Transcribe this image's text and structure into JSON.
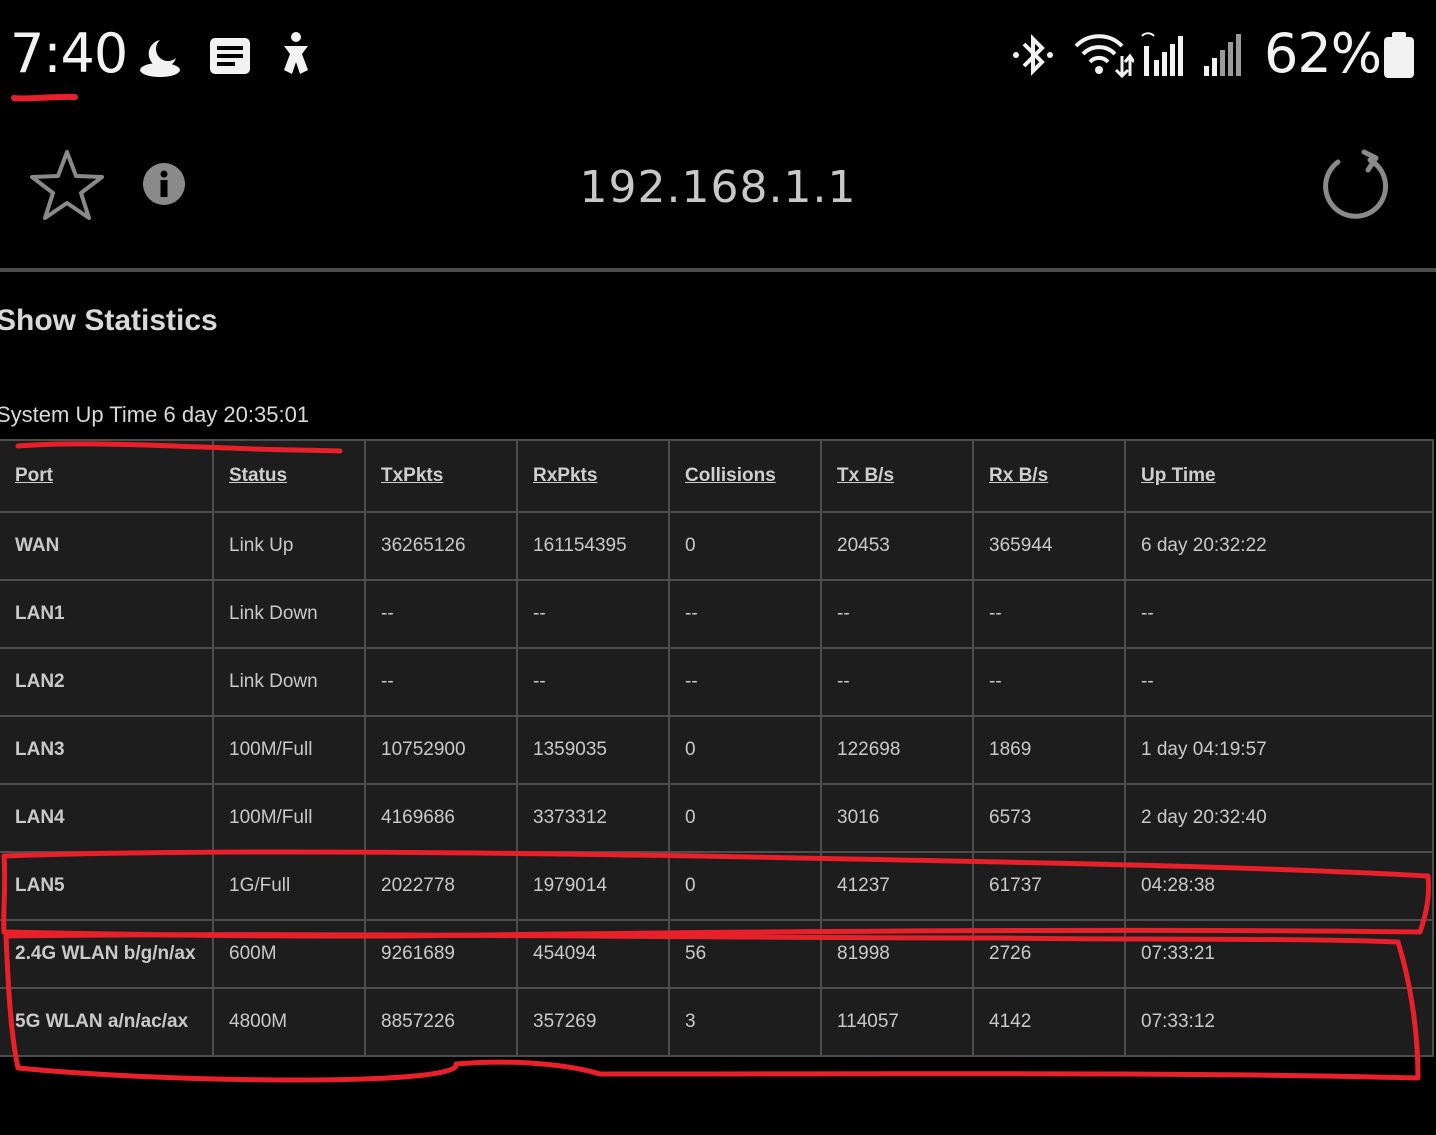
{
  "status_bar": {
    "time": "7:40",
    "battery": "62%",
    "icons": [
      "weather-night-icon",
      "notes-icon",
      "accessibility-icon",
      "bluetooth-icon",
      "wifi-icon",
      "signal-icon",
      "signal-icon-2",
      "battery-icon"
    ]
  },
  "browser": {
    "url": "192.168.1.1",
    "icons": [
      "star-icon",
      "info-icon",
      "reload-icon"
    ]
  },
  "page": {
    "title": "Show Statistics",
    "uptime": "System Up Time 6 day 20:35:01"
  },
  "table": {
    "headers": [
      "Port",
      "Status",
      "TxPkts",
      "RxPkts",
      "Collisions",
      "Tx B/s",
      "Rx B/s",
      "Up Time"
    ],
    "rows": [
      [
        "WAN",
        "Link Up",
        "36265126",
        "161154395",
        "0",
        "20453",
        "365944",
        "6 day 20:32:22"
      ],
      [
        "LAN1",
        "Link Down",
        "--",
        "--",
        "--",
        "--",
        "--",
        "--"
      ],
      [
        "LAN2",
        "Link Down",
        "--",
        "--",
        "--",
        "--",
        "--",
        "--"
      ],
      [
        "LAN3",
        "100M/Full",
        "10752900",
        "1359035",
        "0",
        "122698",
        "1869",
        "1 day 04:19:57"
      ],
      [
        "LAN4",
        "100M/Full",
        "4169686",
        "3373312",
        "0",
        "3016",
        "6573",
        "2 day 20:32:40"
      ],
      [
        "LAN5",
        "1G/Full",
        "2022778",
        "1979014",
        "0",
        "41237",
        "61737",
        "04:28:38"
      ],
      [
        "2.4G WLAN b/g/n/ax",
        "600M",
        "9261689",
        "454094",
        "56",
        "81998",
        "2726",
        "07:33:21"
      ],
      [
        "5G WLAN a/n/ac/ax",
        "4800M",
        "8857226",
        "357269",
        "3",
        "114057",
        "4142",
        "07:33:12"
      ]
    ]
  },
  "colors": {
    "annotation": "#e8202a",
    "table_bg": "#1d1d1d",
    "border": "#4d4d4d"
  }
}
